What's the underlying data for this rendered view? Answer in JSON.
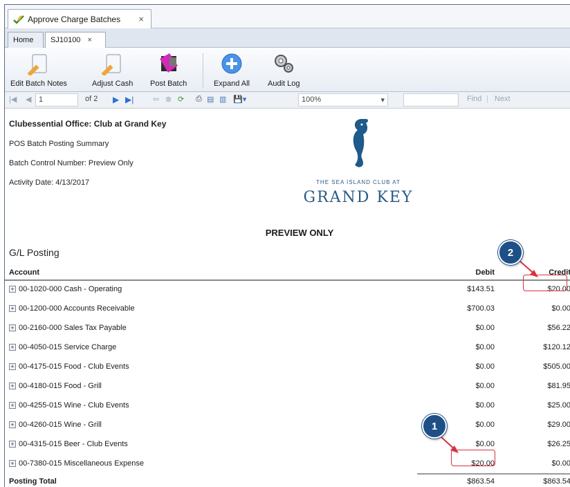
{
  "window_tab": {
    "title": "Approve Charge Batches",
    "close": "×"
  },
  "inner_tabs": [
    {
      "label": "Home"
    },
    {
      "label": "SJ10100",
      "close": "×"
    }
  ],
  "ribbon": {
    "edit_batch_notes": "Edit Batch Notes",
    "adjust_cash": "Adjust Cash",
    "post_batch": "Post Batch",
    "expand_all": "Expand All",
    "audit_log": "Audit Log"
  },
  "report_toolbar": {
    "page_value": "1",
    "page_of": "of 2",
    "zoom": "100%",
    "find": "Find",
    "separator": "|",
    "next": "Next"
  },
  "report": {
    "office": "Clubessential Office: Club at Grand Key",
    "summary_title": "POS Batch Posting Summary",
    "batch_control": "Batch Control Number: Preview Only",
    "activity_date": "Activity Date: 4/13/2017",
    "logo_small": "THE SEA ISLAND CLUB AT",
    "logo_big": "GRAND KEY",
    "preview_label": "PREVIEW ONLY",
    "section": "G/L Posting",
    "columns": {
      "account": "Account",
      "debit": "Debit",
      "credit": "Credit"
    },
    "rows": [
      {
        "account": "00-1020-000 Cash - Operating",
        "debit": "$143.51",
        "credit": "$20.00"
      },
      {
        "account": "00-1200-000 Accounts Receivable",
        "debit": "$700.03",
        "credit": "$0.00"
      },
      {
        "account": "00-2160-000 Sales Tax Payable",
        "debit": "$0.00",
        "credit": "$56.22"
      },
      {
        "account": "00-4050-015 Service Charge",
        "debit": "$0.00",
        "credit": "$120.12"
      },
      {
        "account": "00-4175-015 Food - Club Events",
        "debit": "$0.00",
        "credit": "$505.00"
      },
      {
        "account": "00-4180-015 Food - Grill",
        "debit": "$0.00",
        "credit": "$81.95"
      },
      {
        "account": "00-4255-015 Wine - Club Events",
        "debit": "$0.00",
        "credit": "$25.00"
      },
      {
        "account": "00-4260-015 Wine - Grill",
        "debit": "$0.00",
        "credit": "$29.00"
      },
      {
        "account": "00-4315-015 Beer - Club Events",
        "debit": "$0.00",
        "credit": "$26.25"
      },
      {
        "account": "00-7380-015 Miscellaneous Expense",
        "debit": "$20.00",
        "credit": "$0.00"
      }
    ],
    "total_label": "Posting Total",
    "total_debit": "$863.54",
    "total_credit": "$863.54"
  },
  "callouts": {
    "one": "1",
    "two": "2"
  },
  "colors": {
    "callout": "#1e4f86",
    "highlight": "#d9313e",
    "logo": "#2a5a84"
  }
}
